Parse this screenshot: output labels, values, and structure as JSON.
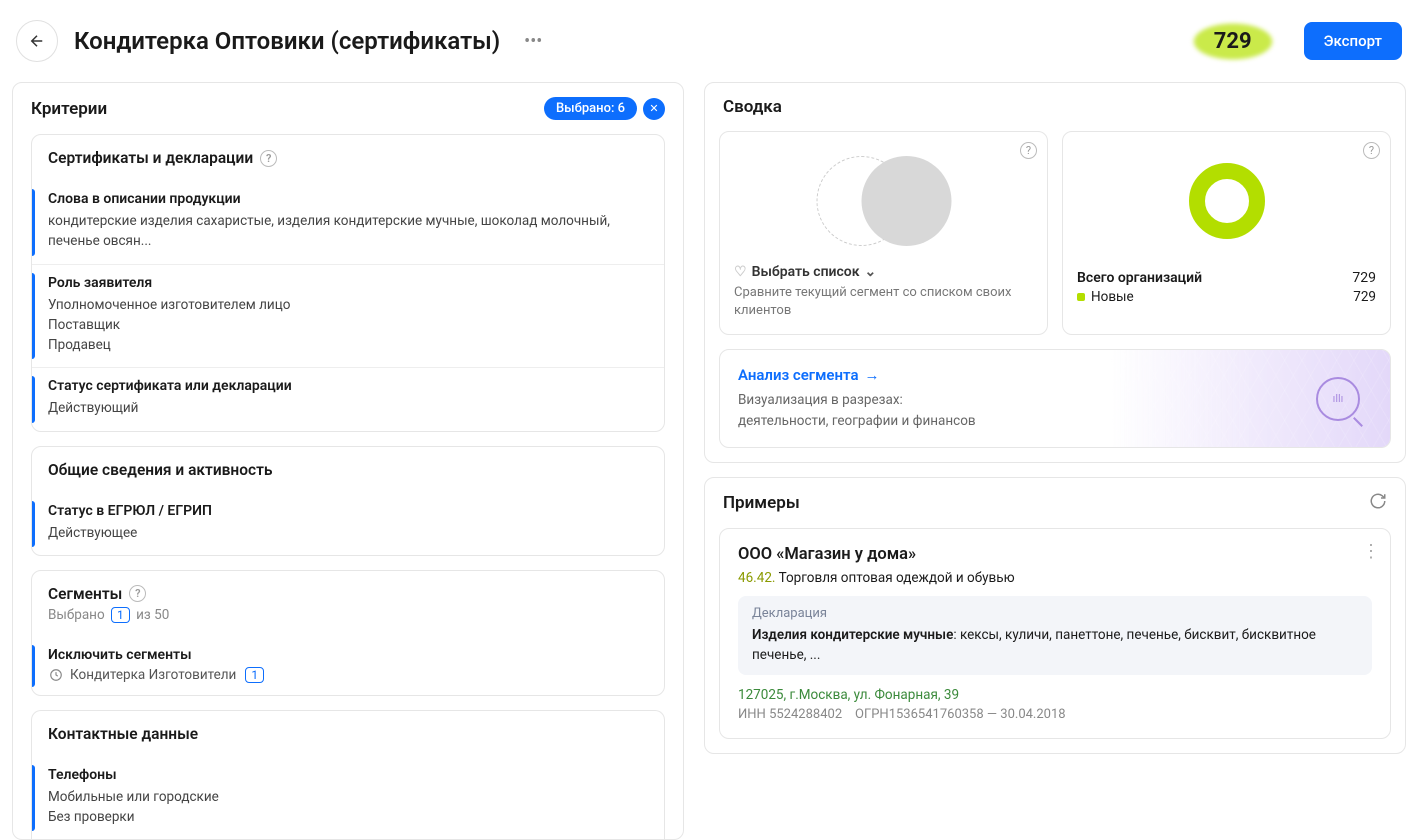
{
  "header": {
    "title": "Кондитерка Оптовики (сертификаты)",
    "count": "729",
    "export_label": "Экспорт"
  },
  "criteria": {
    "title": "Критерии",
    "selected_label": "Выбрано: 6",
    "groups": {
      "certs": {
        "title": "Сертификаты и декларации",
        "items": {
          "words": {
            "name": "Слова в описании продукции",
            "value": "кондитерские изделия сахаристые, изделия кондитерские мучные, шоколад молочный, печенье овсян..."
          },
          "role": {
            "name": "Роль заявителя",
            "value": "Уполномоченное изготовителем лицо\nПоставщик\nПродавец"
          },
          "status": {
            "name": "Статус сертификата или декларации",
            "value": "Действующий"
          }
        }
      },
      "general": {
        "title": "Общие сведения и активность",
        "items": {
          "egrul": {
            "name": "Статус в ЕГРЮЛ / ЕГРИП",
            "value": "Действующее"
          }
        }
      },
      "segments": {
        "title": "Сегменты",
        "sub_prefix": "Выбрано",
        "sub_count": "1",
        "sub_suffix": "из 50",
        "items": {
          "exclude": {
            "name": "Исключить сегменты",
            "tag": "Кондитерка Изготовители",
            "tag_count": "1"
          }
        }
      },
      "contacts": {
        "title": "Контактные данные",
        "items": {
          "phones": {
            "name": "Телефоны",
            "value": "Мобильные или городские\nБез проверки"
          }
        }
      }
    }
  },
  "summary": {
    "title": "Сводка",
    "compare": {
      "choose_list": "Выбрать список",
      "desc": "Сравните текущий сегмент со списком своих клиентов"
    },
    "totals": {
      "label": "Всего организаций",
      "value": "729",
      "new_label": "Новые",
      "new_value": "729"
    },
    "analysis": {
      "link": "Анализ сегмента",
      "desc": "Визуализация в разрезах:\nдеятельности, географии и финансов"
    }
  },
  "examples": {
    "title": "Примеры",
    "card": {
      "name": "ООО «Магазин у дома»",
      "okved": "46.42.",
      "activity": "Торговля оптовая одеждой и обувью",
      "decl_label": "Декларация",
      "decl_bold": "Изделия кондитерские мучные",
      "decl_rest": ": кексы, куличи, панеттоне, печенье, бисквит, бисквитное печенье, ...",
      "address": "127025, г.Москва, ул. Фонарная, 39",
      "inn_label": "ИНН",
      "inn": "5524288402",
      "ogrn_label": "ОГРН",
      "ogrn": "1536541760358",
      "date": "30.04.2018"
    }
  },
  "chart_data": {
    "type": "pie",
    "title": "Всего организаций",
    "series": [
      {
        "name": "Новые",
        "value": 729
      }
    ],
    "total": 729
  }
}
